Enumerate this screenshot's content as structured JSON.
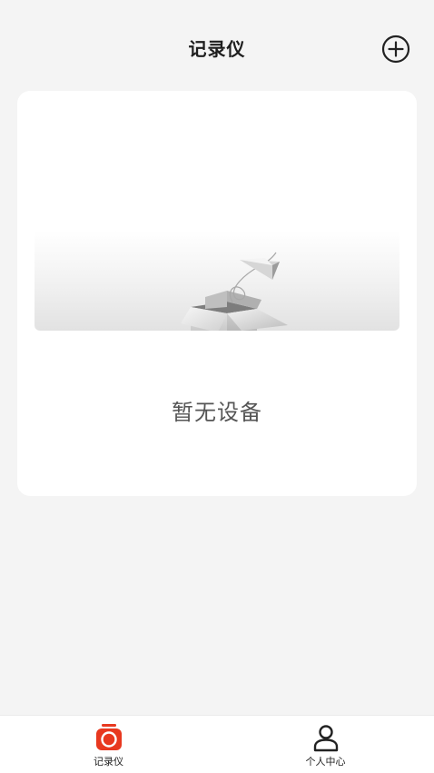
{
  "header": {
    "title": "记录仪",
    "add_icon": "plus-circle-icon"
  },
  "empty_state": {
    "illustration": "empty-box-paper-plane",
    "text": "暂无设备"
  },
  "tabbar": {
    "items": [
      {
        "label": "记录仪",
        "icon": "recorder-icon",
        "active": true
      },
      {
        "label": "个人中心",
        "icon": "person-icon",
        "active": false
      }
    ]
  },
  "colors": {
    "accent": "#e8381f",
    "background": "#f4f4f4",
    "card": "#ffffff",
    "text_muted": "#555555"
  }
}
